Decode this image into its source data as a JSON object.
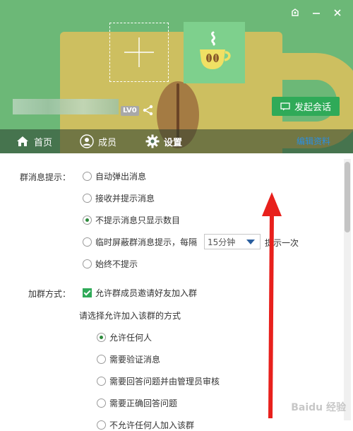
{
  "header": {
    "level_badge": "LV0",
    "chat_button_label": "发起会话",
    "colors": {
      "bg": "#6cb877",
      "accent": "#2faa58",
      "mug": "#cdbf60"
    }
  },
  "tabs": [
    {
      "label": "首页",
      "icon": "home-icon"
    },
    {
      "label": "成员",
      "icon": "member-icon"
    },
    {
      "label": "设置",
      "icon": "gear-icon",
      "active": true
    }
  ],
  "edit_link": "编辑资料",
  "settings": {
    "msg_label": "群消息提示：",
    "msg_options": [
      {
        "label": "自动弹出消息",
        "checked": false
      },
      {
        "label": "接收并提示消息",
        "checked": false
      },
      {
        "label": "不提示消息只显示数目",
        "checked": true
      },
      {
        "label": "临时屏蔽群消息提示，每隔",
        "checked": false
      },
      {
        "label": "始终不提示",
        "checked": false
      }
    ],
    "interval_value": "15分钟",
    "interval_suffix": "提示一次",
    "join_label": "加群方式：",
    "invite_checkbox_label": "允许群成员邀请好友加入群",
    "invite_checked": true,
    "join_method_prompt": "请选择允许加入该群的方式",
    "join_options": [
      {
        "label": "允许任何人",
        "checked": true
      },
      {
        "label": "需要验证消息",
        "checked": false
      },
      {
        "label": "需要回答问题并由管理员审核",
        "checked": false
      },
      {
        "label": "需要正确回答问题",
        "checked": false
      },
      {
        "label": "不允许任何人加入该群",
        "checked": false
      }
    ]
  },
  "watermark": "Baidu 经验"
}
